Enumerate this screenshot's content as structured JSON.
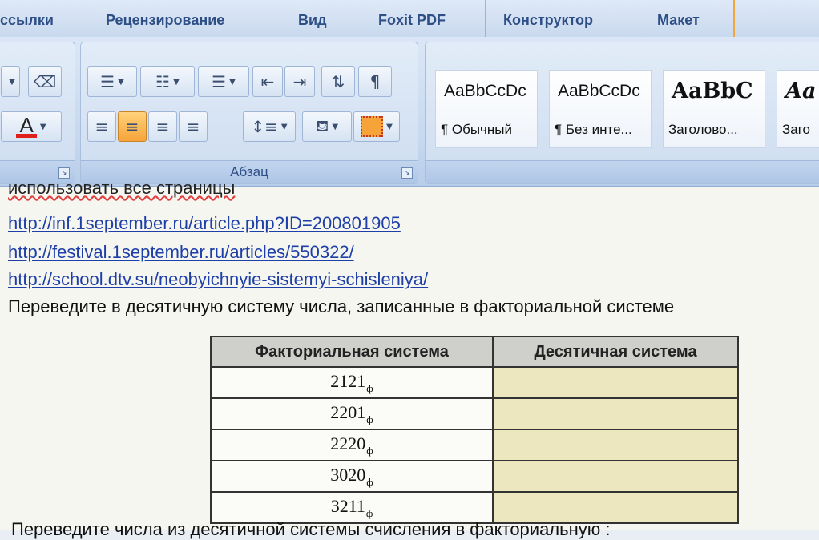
{
  "ribbon_tabs": [
    {
      "label": "ссылки"
    },
    {
      "label": "Рецензирование"
    },
    {
      "label": "Вид"
    },
    {
      "label": "Foxit PDF"
    },
    {
      "label": "Конструктор"
    },
    {
      "label": "Макет"
    }
  ],
  "paragraph_group": {
    "label": "Абзац"
  },
  "styles": [
    {
      "sample": "AaBbCcDc",
      "name": "¶ Обычный"
    },
    {
      "sample": "AaBbCcDc",
      "name": "¶ Без инте..."
    },
    {
      "sample": "AaBbC",
      "name": "Заголово..."
    },
    {
      "sample": "Aa",
      "name": "Заго"
    }
  ],
  "document": {
    "cut_line": "использовать все страницы",
    "links": [
      "http://inf.1september.ru/article.php?ID=200801905",
      "http://festival.1september.ru/articles/550322/",
      "http://school.dtv.su/neobyichnyie-sistemyi-schisleniya/"
    ],
    "instruction": "Переведите в десятичную систему числа, записанные в факториальной системе",
    "table": {
      "headers": [
        "Факториальная система",
        "Десятичная система"
      ],
      "subscript": "ф",
      "rows": [
        "2121",
        "2201",
        "2220",
        "3020",
        "3211"
      ]
    },
    "bottom_text": "Переведите числа из десятичной системы счисления в факториальную :"
  },
  "colors": {
    "link": "#1f3fa8",
    "answer_cell": "#ece7bf",
    "active_button": "#f6a43a"
  }
}
